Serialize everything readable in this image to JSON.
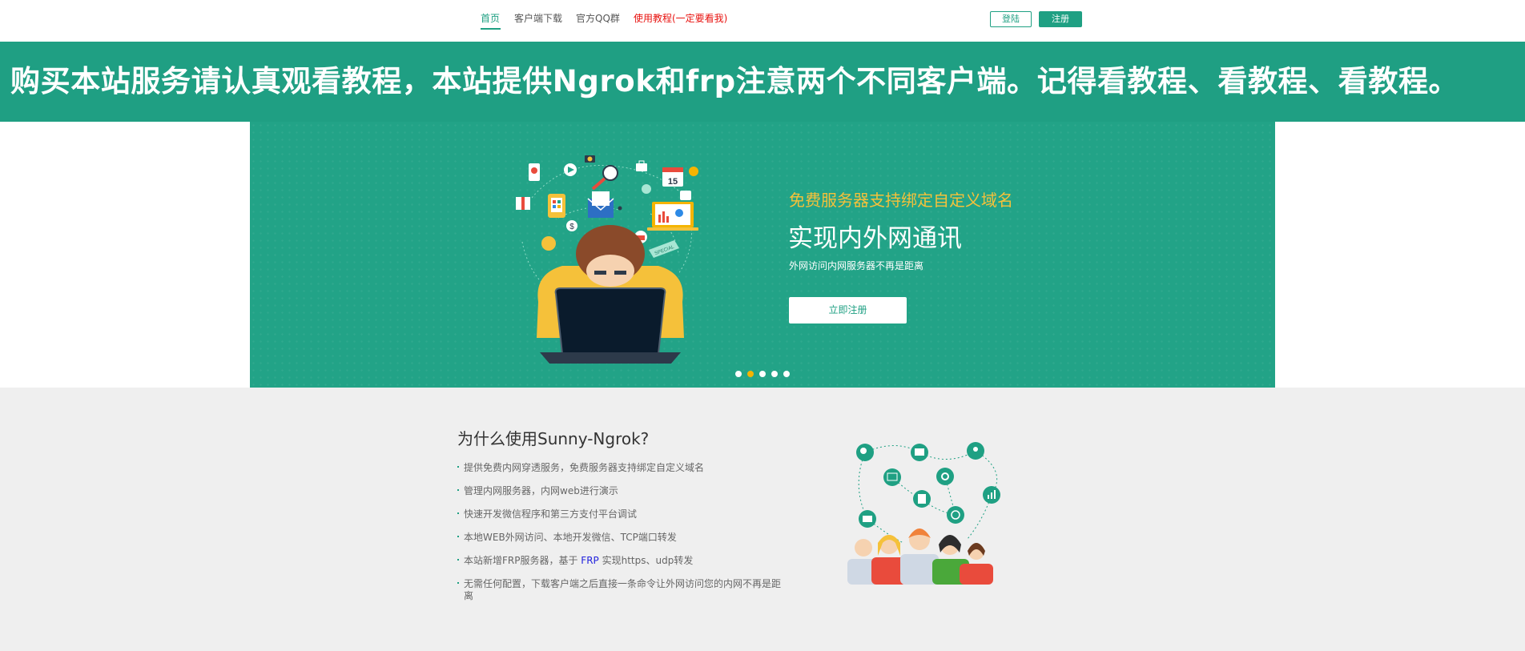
{
  "nav": {
    "links": [
      {
        "label": "首页",
        "active": true
      },
      {
        "label": "客户端下载"
      },
      {
        "label": "官方QQ群"
      },
      {
        "label": "使用教程(一定要看我)",
        "color": "#e8120f"
      }
    ],
    "login_label": "登陆",
    "register_label": "注册"
  },
  "notice": {
    "text": "购买本站服务请认真观看教程，本站提供Ngrok和frp注意两个不同客户端。记得看教程、看教程、看教程。"
  },
  "hero": {
    "kicker": "免费服务器支持绑定自定义域名",
    "title": "实现内外网通讯",
    "subtitle": "外网访问内网服务器不再是距离",
    "cta_label": "立即注册",
    "calendar_day": "15",
    "badge_text": "SPECIAL",
    "active_slide": 2,
    "slide_count": 5
  },
  "features": {
    "heading": "为什么使用Sunny-Ngrok?",
    "items": [
      "提供免费内网穿透服务，免费服务器支持绑定自定义域名",
      "管理内网服务器，内网web进行演示",
      "快速开发微信程序和第三方支付平台调试",
      "本地WEB外网访问、本地开发微信、TCP端口转发"
    ],
    "frp_item": {
      "before": "本站新增FRP服务器，基于 ",
      "link": "FRP",
      "after": " 实现https、udp转发"
    },
    "last_item": "无需任何配置，下载客户端之后直接一条命令让外网访问您的内网不再是距离"
  },
  "colors": {
    "brand_green": "#1fa083",
    "accent_yellow": "#f5c13a",
    "alert_red": "#e8120f",
    "section_bg": "#efefef"
  }
}
